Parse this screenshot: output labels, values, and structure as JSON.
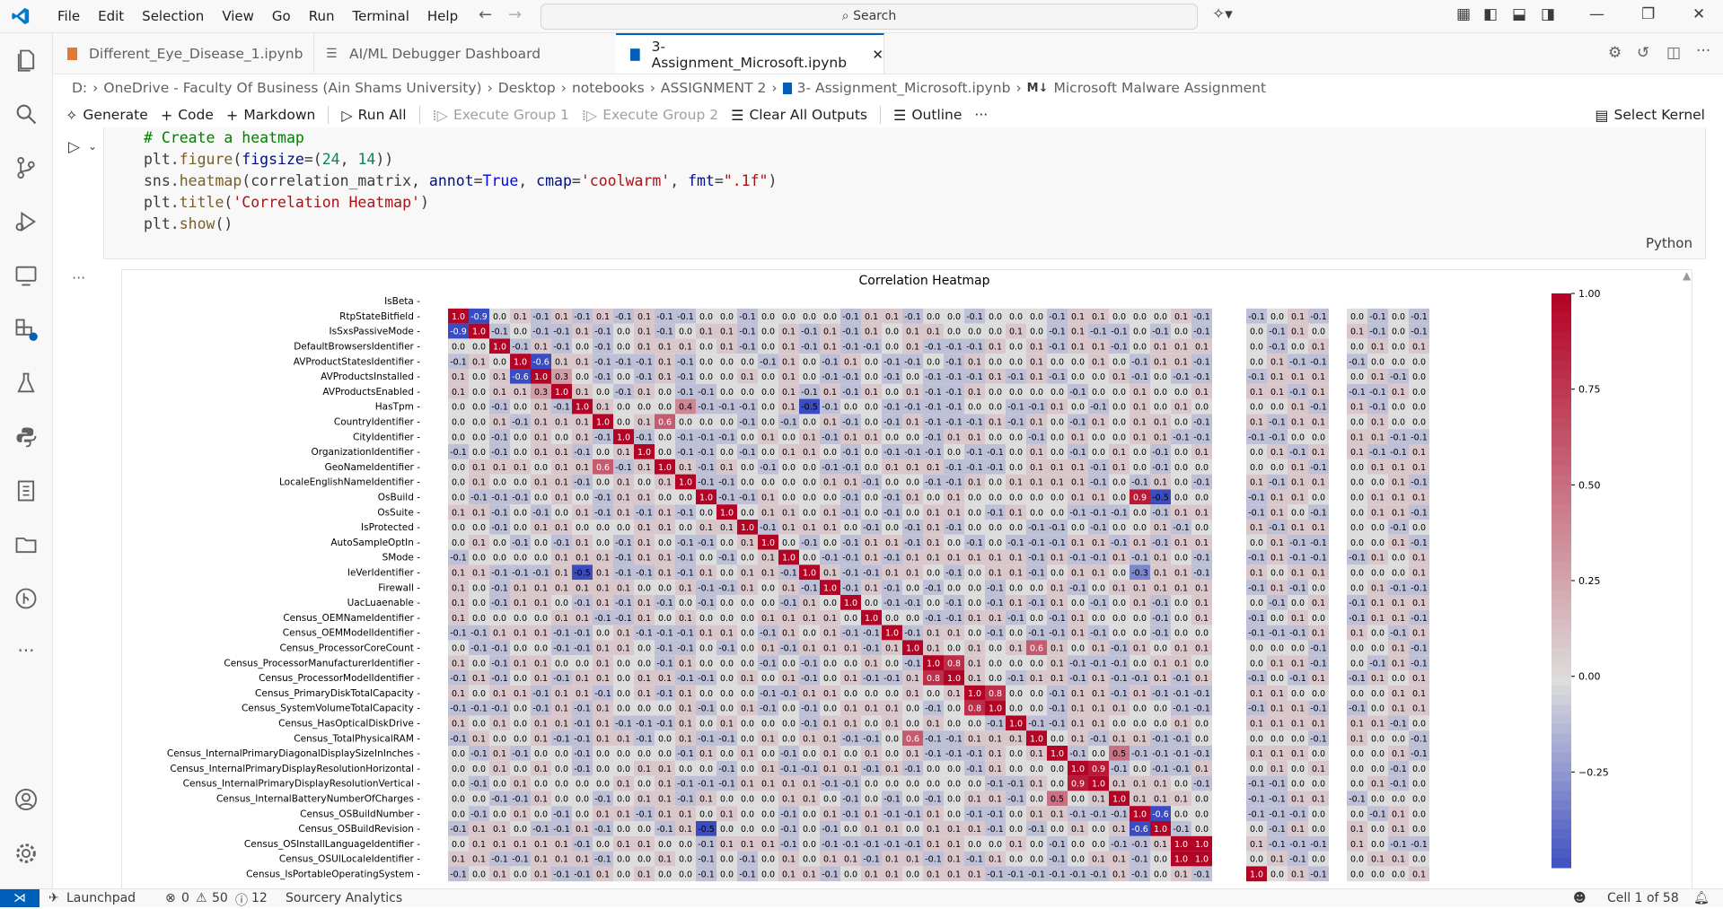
{
  "menu": [
    "File",
    "Edit",
    "Selection",
    "View",
    "Go",
    "Run",
    "Terminal",
    "Help"
  ],
  "search": {
    "label": "Search"
  },
  "tabs": [
    {
      "label": "Different_Eye_Disease_1.ipynb"
    },
    {
      "label": "AI/ML Debugger Dashboard"
    },
    {
      "label": "3- Assignment_Microsoft.ipynb"
    }
  ],
  "breadcrumb": [
    "D:",
    "OneDrive - Faculty Of Business (Ain Shams University)",
    "Desktop",
    "notebooks",
    "ASSIGNMENT 2",
    "3- Assignment_Microsoft.ipynb",
    "Microsoft Malware Assignment"
  ],
  "breadcrumb_tail_icon": "M↓",
  "toolbar": {
    "generate": "Generate",
    "code": "Code",
    "markdown": "Markdown",
    "run_all": "Run All",
    "exec1": "Execute Group 1",
    "exec2": "Execute Group 2",
    "clear": "Clear All Outputs",
    "outline": "Outline",
    "more": "···",
    "kernel": "Select Kernel"
  },
  "cell": {
    "comment": "# Create a heatmap",
    "language": "Python"
  },
  "status": {
    "launchpad": "Launchpad",
    "errors": "0",
    "warnings": "50",
    "infos": "12",
    "sourcery": "Sourcery Analytics",
    "cell": "Cell 1 of 58"
  },
  "colors": {
    "accent": "#005fb8",
    "cold": "#3b4cc0",
    "neutral": "#dddddd",
    "hot": "#b40426"
  },
  "chart_data": {
    "type": "heatmap",
    "title": "Correlation Heatmap",
    "rows": [
      "IsBeta",
      "RtpStateBitfield",
      "IsSxsPassiveMode",
      "DefaultBrowsersIdentifier",
      "AVProductStatesIdentifier",
      "AVProductsInstalled",
      "AVProductsEnabled",
      "HasTpm",
      "CountryIdentifier",
      "CityIdentifier",
      "OrganizationIdentifier",
      "GeoNameIdentifier",
      "LocaleEnglishNameIdentifier",
      "OsBuild",
      "OsSuite",
      "IsProtected",
      "AutoSampleOptIn",
      "SMode",
      "IeVerIdentifier",
      "Firewall",
      "UacLuaenable",
      "Census_OEMNameIdentifier",
      "Census_OEMModelIdentifier",
      "Census_ProcessorCoreCount",
      "Census_ProcessorManufacturerIdentifier",
      "Census_ProcessorModelIdentifier",
      "Census_PrimaryDiskTotalCapacity",
      "Census_SystemVolumeTotalCapacity",
      "Census_HasOpticalDiskDrive",
      "Census_TotalPhysicalRAM",
      "Census_InternalPrimaryDiagonalDisplaySizeInInches",
      "Census_InternalPrimaryDisplayResolutionHorizontal",
      "Census_InternalPrimaryDisplayResolutionVertical",
      "Census_InternalBatteryNumberOfCharges",
      "Census_OSBuildNumber",
      "Census_OSBuildRevision",
      "Census_OSInstallLanguageIdentifier",
      "Census_OSUILocaleIdentifier",
      "Census_IsPortableOperatingSystem"
    ],
    "fmt": ".1f",
    "colormap": "coolwarm",
    "colorbar_ticks": [
      "1.00",
      "0.75",
      "0.50",
      "0.25",
      "0.00",
      "−0.25"
    ],
    "vmin": -0.5,
    "vmax": 1.0,
    "highlights": [
      [
        1,
        1,
        1.0
      ],
      [
        1,
        2,
        -0.9
      ],
      [
        2,
        1,
        -0.9
      ],
      [
        2,
        2,
        1.0
      ],
      [
        3,
        3,
        1.0
      ],
      [
        4,
        4,
        1.0
      ],
      [
        4,
        5,
        -0.6
      ],
      [
        5,
        4,
        -0.6
      ],
      [
        5,
        5,
        1.0
      ],
      [
        5,
        6,
        0.3
      ],
      [
        6,
        5,
        0.3
      ],
      [
        6,
        6,
        1.0
      ],
      [
        7,
        7,
        1.0
      ],
      [
        7,
        12,
        0.4
      ],
      [
        7,
        18,
        -0.5
      ],
      [
        8,
        8,
        1.0
      ],
      [
        8,
        11,
        0.6
      ],
      [
        9,
        9,
        1.0
      ],
      [
        10,
        10,
        1.0
      ],
      [
        11,
        11,
        1.0
      ],
      [
        11,
        8,
        0.6
      ],
      [
        12,
        12,
        1.0
      ],
      [
        13,
        13,
        1.0
      ],
      [
        13,
        34,
        0.9
      ],
      [
        13,
        35,
        -0.5
      ],
      [
        14,
        14,
        1.0
      ],
      [
        15,
        15,
        1.0
      ],
      [
        16,
        16,
        1.0
      ],
      [
        17,
        17,
        1.0
      ],
      [
        18,
        18,
        1.0
      ],
      [
        18,
        7,
        -0.5
      ],
      [
        18,
        34,
        -0.3
      ],
      [
        19,
        19,
        1.0
      ],
      [
        20,
        20,
        1.0
      ],
      [
        21,
        21,
        1.0
      ],
      [
        22,
        22,
        1.0
      ],
      [
        23,
        23,
        1.0
      ],
      [
        23,
        29,
        0.6
      ],
      [
        24,
        24,
        1.0
      ],
      [
        24,
        25,
        0.8
      ],
      [
        25,
        25,
        1.0
      ],
      [
        25,
        24,
        0.8
      ],
      [
        26,
        26,
        1.0
      ],
      [
        26,
        27,
        0.8
      ],
      [
        27,
        27,
        1.0
      ],
      [
        27,
        26,
        0.8
      ],
      [
        28,
        28,
        1.0
      ],
      [
        29,
        29,
        1.0
      ],
      [
        29,
        23,
        0.6
      ],
      [
        30,
        30,
        1.0
      ],
      [
        30,
        33,
        0.5
      ],
      [
        31,
        31,
        1.0
      ],
      [
        31,
        32,
        0.9
      ],
      [
        32,
        32,
        1.0
      ],
      [
        32,
        31,
        0.9
      ],
      [
        33,
        33,
        1.0
      ],
      [
        33,
        30,
        0.5
      ],
      [
        34,
        34,
        1.0
      ],
      [
        34,
        35,
        -0.6
      ],
      [
        35,
        35,
        1.0
      ],
      [
        35,
        34,
        -0.6
      ],
      [
        35,
        13,
        -0.5
      ],
      [
        36,
        36,
        1.0
      ],
      [
        36,
        37,
        1.0
      ],
      [
        37,
        37,
        1.0
      ],
      [
        37,
        36,
        1.0
      ],
      [
        38,
        38,
        1.0
      ]
    ]
  }
}
